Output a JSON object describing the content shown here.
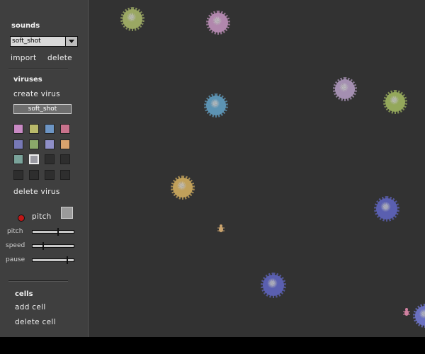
{
  "sidebar": {
    "sounds_header": "sounds",
    "sound_select": {
      "value": "soft_shot"
    },
    "import_label": "import",
    "delete_label": "delete",
    "viruses_header": "viruses",
    "create_virus_label": "create virus",
    "virus_name": "soft_shot",
    "swatches": [
      "#c98ac4",
      "#b9b96a",
      "#6d95c4",
      "#c9728c",
      "#7779b6",
      "#8aa86a",
      "#8f8fc8",
      "#d8a26d",
      "#7aa39a",
      "#9a9aa2",
      "empty",
      "empty",
      "empty",
      "empty",
      "empty",
      "empty"
    ],
    "selected_swatch": 9,
    "delete_virus_label": "delete virus",
    "pitch_toggle_label": "pitch",
    "sliders": [
      {
        "label": "pitch",
        "value": 0.62
      },
      {
        "label": "speed",
        "value": 0.25
      },
      {
        "label": "pause",
        "value": 0.85
      }
    ],
    "cells_header": "cells",
    "add_cell_label": "add cell",
    "delete_cell_label": "delete cell"
  },
  "colors": {
    "sidebar_bg": "#3f3f3f",
    "canvas_bg": "#323232"
  },
  "canvas": {
    "viruses": [
      {
        "color": "#9aa763"
      },
      {
        "color": "#b187ad"
      },
      {
        "color": "#a48fb1"
      },
      {
        "color": "#94a85b"
      },
      {
        "color": "#5c93b3"
      },
      {
        "color": "#c0a05a"
      },
      {
        "color": "#5a5fb0"
      },
      {
        "color": "#5a5fb0"
      },
      {
        "color": "#6a70c0"
      }
    ],
    "cells": [
      {
        "color": "#c9a36d"
      },
      {
        "color": "#d080a0"
      }
    ]
  }
}
